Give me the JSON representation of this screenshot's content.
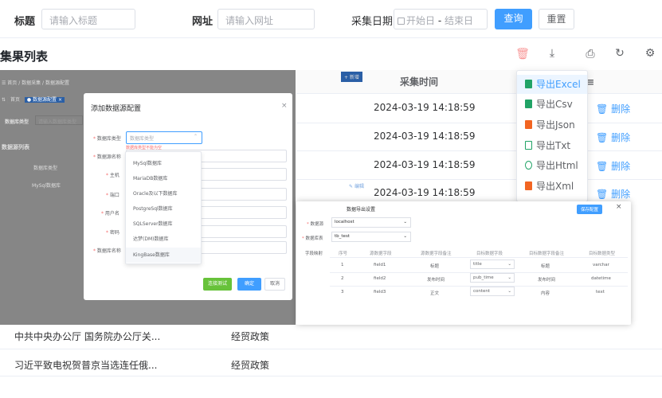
{
  "search": {
    "title_label": "标题",
    "title_placeholder": "请输入标题",
    "url_label": "网址",
    "url_placeholder": "请输入网址",
    "date_label": "采集日期",
    "date_start": "开始日",
    "date_sep": "-",
    "date_end": "结束日",
    "query_btn": "查询",
    "reset_btn": "重置"
  },
  "section_title": "集果列表",
  "table": {
    "col_time": "采集时间",
    "rows": [
      {
        "time": "2024-03-19 14:18:59",
        "delete": "删除"
      },
      {
        "time": "2024-03-19 14:18:59",
        "delete": "删除"
      },
      {
        "time": "2024-03-19 14:18:59",
        "delete": "删除"
      },
      {
        "time": "2024-03-19 14:18:59",
        "delete": "删除"
      }
    ],
    "bottom_rows": [
      {
        "title": "中共中央办公厅 国务院办公厅关...",
        "category": "经贸政策"
      },
      {
        "title": "习近平致电祝贺普京当选连任俄...",
        "category": "经贸政策"
      }
    ]
  },
  "export_menu": {
    "items": [
      {
        "label": "导出Excel",
        "color": "#21a366"
      },
      {
        "label": "导出Csv",
        "color": "#21a366"
      },
      {
        "label": "导出Json",
        "color": "#f26522"
      },
      {
        "label": "导出Txt",
        "color": "#21a366"
      },
      {
        "label": "导出Html",
        "color": "#21a366"
      },
      {
        "label": "导出Xml",
        "color": "#f26522"
      }
    ]
  },
  "bg_page": {
    "breadcrumb": "首页 / 数据采集 / 数据源配置",
    "tab_home": "首页",
    "tab_active": "数据源配置",
    "filter_label": "数据库类型",
    "filter_placeholder": "请输入数据库类型",
    "list_title": "数据源列表",
    "add_btn": "+ 新增",
    "col_type": "数据库类型",
    "row_type": "MySql数据库",
    "edit_link": "编辑"
  },
  "dialog": {
    "title": "添加数据源配置",
    "close": "×",
    "db_type_label": "数据库类型",
    "db_type_placeholder": "数据库类型",
    "db_type_error": "数据库类型不能为空",
    "db_name_label": "数据源名称",
    "host_label": "主机",
    "port_label": "端口",
    "user_label": "用户名",
    "pwd_label": "密码",
    "dbname_label": "数据库名称",
    "test_btn": "连接测试",
    "ok_btn": "确定",
    "cancel_btn": "取消",
    "options": [
      "MySql数据库",
      "MariaDB数据库",
      "Oracle及以下数据库",
      "PostgreSql数据库",
      "SQLServer数据库",
      "达梦(DM)数据库",
      "KingBase数据库"
    ]
  },
  "panel": {
    "title": "数据导出设置",
    "save_btn": "保存配置",
    "close": "×",
    "source_label": "数据源",
    "source_value": "localhost",
    "table_label": "数据库表",
    "table_value": "tb_test",
    "mapping_label": "字段映射",
    "headers": [
      "序号",
      "源数据字段",
      "源数据字段备注",
      "目标数据字段",
      "目标数据字段备注",
      "目标数据类型"
    ],
    "rows": [
      [
        "1",
        "field1",
        "标题",
        "title",
        "标题",
        "varchar"
      ],
      [
        "2",
        "field2",
        "发布时间",
        "pub_time",
        "发布时间",
        "datetime"
      ],
      [
        "3",
        "field3",
        "正文",
        "content",
        "内容",
        "text"
      ]
    ]
  },
  "colors": {
    "primary": "#409eff",
    "danger": "#f56c6c"
  }
}
